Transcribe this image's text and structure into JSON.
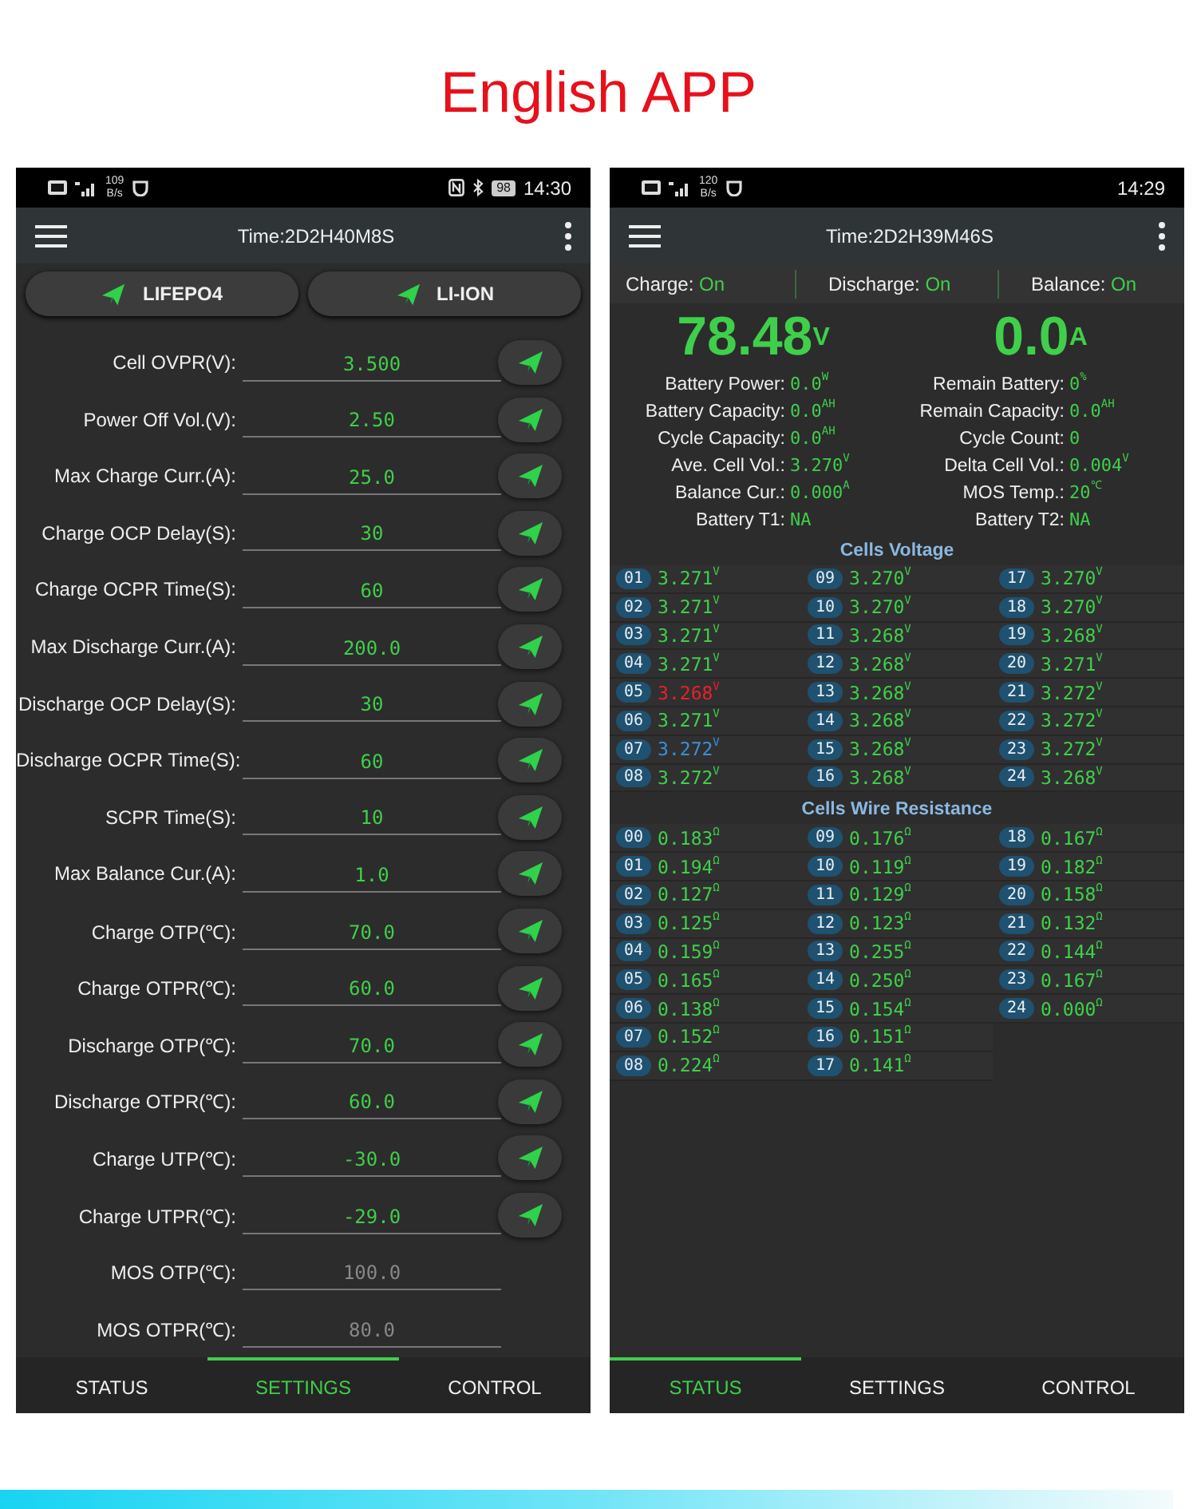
{
  "title": "English APP",
  "phones": [
    {
      "kind": "settings",
      "status_bar": {
        "speed": "109",
        "speed_unit": "B/s",
        "battery": "98",
        "time": "14:30"
      },
      "app_bar": {
        "title": "Time:2D2H40M8S"
      },
      "presets": [
        "LIFEPO4",
        "LI-ION"
      ],
      "settings": [
        {
          "label": "Cell OVPR(V):",
          "value": "3.500",
          "disabled": false
        },
        {
          "label": "Power Off Vol.(V):",
          "value": "2.50",
          "disabled": false
        },
        {
          "label": "Max Charge Curr.(A):",
          "value": "25.0",
          "disabled": false
        },
        {
          "label": "Charge OCP Delay(S):",
          "value": "30",
          "disabled": false
        },
        {
          "label": "Charge OCPR Time(S):",
          "value": "60",
          "disabled": false
        },
        {
          "label": "Max Discharge Curr.(A):",
          "value": "200.0",
          "disabled": false
        },
        {
          "label": "Discharge OCP Delay(S):",
          "value": "30",
          "disabled": false
        },
        {
          "label": "Discharge OCPR Time(S):",
          "value": "60",
          "disabled": false
        },
        {
          "label": "SCPR Time(S):",
          "value": "10",
          "disabled": false
        },
        {
          "label": "Max Balance Cur.(A):",
          "value": "1.0",
          "disabled": false
        },
        {
          "label": "Charge OTP(℃):",
          "value": "70.0",
          "disabled": false
        },
        {
          "label": "Charge OTPR(℃):",
          "value": "60.0",
          "disabled": false
        },
        {
          "label": "Discharge OTP(℃):",
          "value": "70.0",
          "disabled": false
        },
        {
          "label": "Discharge OTPR(℃):",
          "value": "60.0",
          "disabled": false
        },
        {
          "label": "Charge UTP(℃):",
          "value": "-30.0",
          "disabled": false
        },
        {
          "label": "Charge UTPR(℃):",
          "value": "-29.0",
          "disabled": false
        },
        {
          "label": "MOS OTP(℃):",
          "value": "100.0",
          "disabled": true
        },
        {
          "label": "MOS OTPR(℃):",
          "value": "80.0",
          "disabled": true
        }
      ],
      "nav": [
        {
          "label": "STATUS",
          "selected": false
        },
        {
          "label": "SETTINGS",
          "selected": true
        },
        {
          "label": "CONTROL",
          "selected": false
        }
      ]
    },
    {
      "kind": "status",
      "status_bar": {
        "speed": "120",
        "speed_unit": "B/s",
        "time": "14:29"
      },
      "app_bar": {
        "title": "Time:2D2H39M46S"
      },
      "switches": [
        {
          "label": "Charge:",
          "value": "On"
        },
        {
          "label": "Discharge:",
          "value": "On"
        },
        {
          "label": "Balance:",
          "value": "On"
        }
      ],
      "voltage": "78.48$^{V}$",
      "current": "0.0$^{A}$",
      "stats_left": [
        {
          "label": "Battery Power:",
          "value": "0.0$^{W}$"
        },
        {
          "label": "Battery Capacity:",
          "value": "0.0$^{AH}$"
        },
        {
          "label": "Cycle Capacity:",
          "value": "0.0$^{AH}$"
        },
        {
          "label": "Ave. Cell Vol.:",
          "value": "3.270$^{V}$"
        },
        {
          "label": "Balance Cur.:",
          "value": "0.000$^{A}$"
        },
        {
          "label": "Battery T1:",
          "value": "NA"
        }
      ],
      "stats_right": [
        {
          "label": "Remain Battery:",
          "value": "0$^{%}$"
        },
        {
          "label": "Remain Capacity:",
          "value": "0.0$^{AH}$"
        },
        {
          "label": "Cycle Count:",
          "value": "0"
        },
        {
          "label": "Delta Cell Vol.:",
          "value": "0.004$^{V}$"
        },
        {
          "label": "MOS Temp.:",
          "value": "20$^{℃}$"
        },
        {
          "label": "Battery T2:",
          "value": "NA"
        }
      ],
      "cells_voltage": {
        "title": "Cells Voltage",
        "cells": [
          {
            "index": "01",
            "value": "3.271$^{V}$",
            "color": "#3fcf4a"
          },
          {
            "index": "02",
            "value": "3.271$^{V}$",
            "color": "#3fcf4a"
          },
          {
            "index": "03",
            "value": "3.271$^{V}$",
            "color": "#3fcf4a"
          },
          {
            "index": "04",
            "value": "3.271$^{V}$",
            "color": "#3fcf4a"
          },
          {
            "index": "05",
            "value": "3.268$^{V}$",
            "color": "#e8202a"
          },
          {
            "index": "06",
            "value": "3.271$^{V}$",
            "color": "#3fcf4a"
          },
          {
            "index": "07",
            "value": "3.272$^{V}$",
            "color": "#3b8fd8"
          },
          {
            "index": "08",
            "value": "3.272$^{V}$",
            "color": "#3fcf4a"
          },
          {
            "index": "09",
            "value": "3.270$^{V}$",
            "color": "#3fcf4a"
          },
          {
            "index": "10",
            "value": "3.270$^{V}$",
            "color": "#3fcf4a"
          },
          {
            "index": "11",
            "value": "3.268$^{V}$",
            "color": "#3fcf4a"
          },
          {
            "index": "12",
            "value": "3.268$^{V}$",
            "color": "#3fcf4a"
          },
          {
            "index": "13",
            "value": "3.268$^{V}$",
            "color": "#3fcf4a"
          },
          {
            "index": "14",
            "value": "3.268$^{V}$",
            "color": "#3fcf4a"
          },
          {
            "index": "15",
            "value": "3.268$^{V}$",
            "color": "#3fcf4a"
          },
          {
            "index": "16",
            "value": "3.268$^{V}$",
            "color": "#3fcf4a"
          },
          {
            "index": "17",
            "value": "3.270$^{V}$",
            "color": "#3fcf4a"
          },
          {
            "index": "18",
            "value": "3.270$^{V}$",
            "color": "#3fcf4a"
          },
          {
            "index": "19",
            "value": "3.268$^{V}$",
            "color": "#3fcf4a"
          },
          {
            "index": "20",
            "value": "3.271$^{V}$",
            "color": "#3fcf4a"
          },
          {
            "index": "21",
            "value": "3.272$^{V}$",
            "color": "#3fcf4a"
          },
          {
            "index": "22",
            "value": "3.272$^{V}$",
            "color": "#3fcf4a"
          },
          {
            "index": "23",
            "value": "3.272$^{V}$",
            "color": "#3fcf4a"
          },
          {
            "index": "24",
            "value": "3.268$^{V}$",
            "color": "#3fcf4a"
          }
        ]
      },
      "wire_resistance": {
        "title": "Cells Wire Resistance",
        "cells": [
          {
            "index": "00",
            "value": "0.183$^{Ω}$"
          },
          {
            "index": "01",
            "value": "0.194$^{Ω}$"
          },
          {
            "index": "02",
            "value": "0.127$^{Ω}$"
          },
          {
            "index": "03",
            "value": "0.125$^{Ω}$"
          },
          {
            "index": "04",
            "value": "0.159$^{Ω}$"
          },
          {
            "index": "05",
            "value": "0.165$^{Ω}$"
          },
          {
            "index": "06",
            "value": "0.138$^{Ω}$"
          },
          {
            "index": "07",
            "value": "0.152$^{Ω}$"
          },
          {
            "index": "08",
            "value": "0.224$^{Ω}$"
          },
          {
            "index": "09",
            "value": "0.176$^{Ω}$"
          },
          {
            "index": "10",
            "value": "0.119$^{Ω}$"
          },
          {
            "index": "11",
            "value": "0.129$^{Ω}$"
          },
          {
            "index": "12",
            "value": "0.123$^{Ω}$"
          },
          {
            "index": "13",
            "value": "0.255$^{Ω}$"
          },
          {
            "index": "14",
            "value": "0.250$^{Ω}$"
          },
          {
            "index": "15",
            "value": "0.154$^{Ω}$"
          },
          {
            "index": "16",
            "value": "0.151$^{Ω}$"
          },
          {
            "index": "17",
            "value": "0.141$^{Ω}$"
          },
          {
            "index": "18",
            "value": "0.167$^{Ω}$"
          },
          {
            "index": "19",
            "value": "0.182$^{Ω}$"
          },
          {
            "index": "20",
            "value": "0.158$^{Ω}$"
          },
          {
            "index": "21",
            "value": "0.132$^{Ω}$"
          },
          {
            "index": "22",
            "value": "0.144$^{Ω}$"
          },
          {
            "index": "23",
            "value": "0.167$^{Ω}$"
          },
          {
            "index": "24",
            "value": "0.000$^{Ω}$"
          }
        ]
      },
      "nav": [
        {
          "label": "STATUS",
          "selected": true
        },
        {
          "label": "SETTINGS",
          "selected": false
        },
        {
          "label": "CONTROL",
          "selected": false
        }
      ]
    }
  ]
}
